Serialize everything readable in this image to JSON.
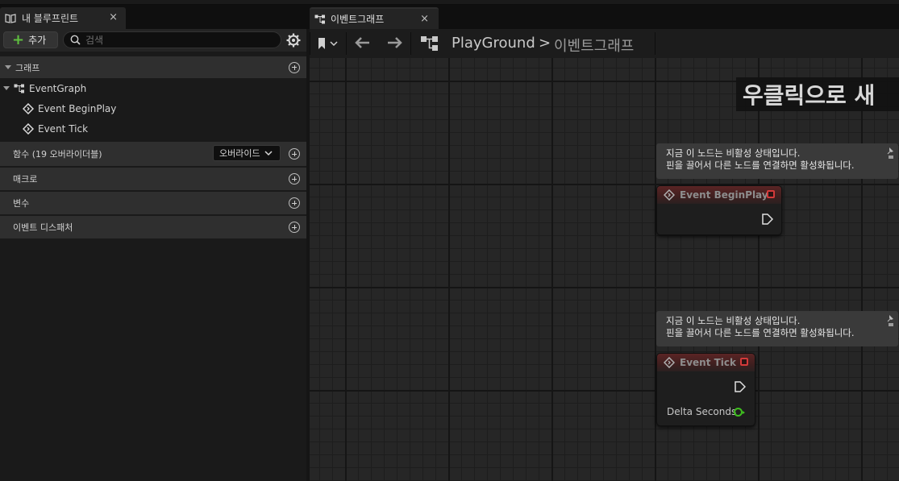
{
  "left_panel": {
    "tab_title": "내 블루프린트",
    "tab_close": "×",
    "add_label": "추가",
    "search_placeholder": "검색",
    "sections": {
      "graph": "그래프",
      "functions": "함수 (19 오버라이더블)",
      "override_label": "오버라이드",
      "macros": "매크로",
      "variables": "변수",
      "dispatchers": "이벤트 디스패처"
    },
    "tree": {
      "root": "EventGraph",
      "items": [
        "Event BeginPlay",
        "Event Tick"
      ]
    }
  },
  "graph_panel": {
    "tab_title": "이벤트그래프",
    "tab_close": "×",
    "breadcrumb": {
      "root": "PlayGround",
      "separator": ">",
      "current": "이벤트그래프"
    },
    "right_click_banner": "우클릭으로 새",
    "nodes": [
      {
        "comment_line1": "지금 이 노드는 비활성 상태입니다.",
        "comment_line2": "핀을 끌어서 다른 노드를 연결하면 활성화됩니다.",
        "title": "Event BeginPlay"
      },
      {
        "comment_line1": "지금 이 노드는 비활성 상태입니다.",
        "comment_line2": "핀을 끌어서 다른 노드를 연결하면 활성화됩니다.",
        "title": "Event Tick",
        "output_pin": "Delta Seconds"
      }
    ]
  },
  "colors": {
    "add_accent": "#5fbf3f",
    "event_node_header": "#5a2424",
    "delegate_pin": "#d43a3a",
    "float_pin": "#3fbf1f"
  }
}
